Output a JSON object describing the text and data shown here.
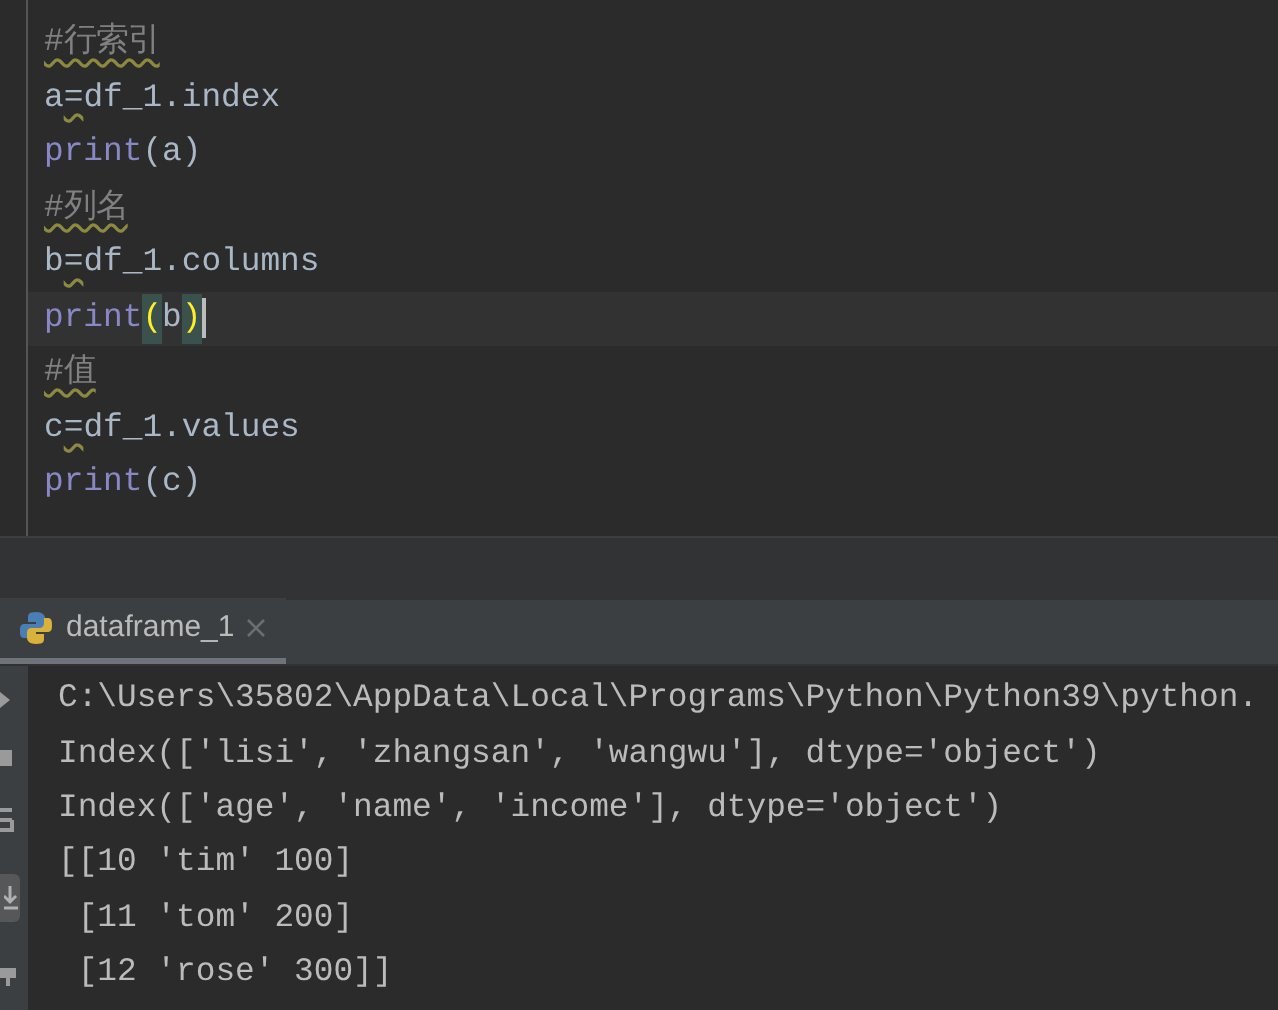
{
  "editor": {
    "lines": [
      {
        "current": false,
        "tokens": [
          {
            "text": "#行索引",
            "kind": "comment"
          }
        ]
      },
      {
        "current": false,
        "tokens": [
          {
            "text": "a",
            "kind": "code"
          },
          {
            "text": "=",
            "kind": "warn"
          },
          {
            "text": "df_1.index",
            "kind": "code"
          }
        ]
      },
      {
        "current": false,
        "tokens": [
          {
            "text": "print",
            "kind": "builtin"
          },
          {
            "text": "(a)",
            "kind": "code"
          }
        ]
      },
      {
        "current": false,
        "tokens": [
          {
            "text": "#列名",
            "kind": "comment"
          }
        ]
      },
      {
        "current": false,
        "tokens": [
          {
            "text": "b",
            "kind": "code"
          },
          {
            "text": "=",
            "kind": "warn"
          },
          {
            "text": "df_1.columns",
            "kind": "code"
          }
        ]
      },
      {
        "current": true,
        "tokens": [
          {
            "text": "print",
            "kind": "builtin"
          },
          {
            "text": "(",
            "kind": "matched"
          },
          {
            "text": "b",
            "kind": "code"
          },
          {
            "text": ")",
            "kind": "matched"
          }
        ]
      },
      {
        "current": false,
        "tokens": [
          {
            "text": "#值",
            "kind": "comment"
          }
        ]
      },
      {
        "current": false,
        "tokens": [
          {
            "text": "c",
            "kind": "code"
          },
          {
            "text": "=",
            "kind": "warn"
          },
          {
            "text": "df_1.values",
            "kind": "code"
          }
        ]
      },
      {
        "current": false,
        "tokens": [
          {
            "text": "print",
            "kind": "builtin"
          },
          {
            "text": "(c)",
            "kind": "code"
          }
        ]
      }
    ]
  },
  "run_tab": {
    "label": "dataframe_1",
    "selected": true
  },
  "console": {
    "lines": [
      "C:\\Users\\35802\\AppData\\Local\\Programs\\Python\\Python39\\python.",
      "Index(['lisi', 'zhangsan', 'wangwu'], dtype='object')",
      "Index(['age', 'name', 'income'], dtype='object')",
      "[[10 'tim' 100]",
      " [11 'tom' 200]",
      " [12 'rose' 300]]"
    ]
  }
}
